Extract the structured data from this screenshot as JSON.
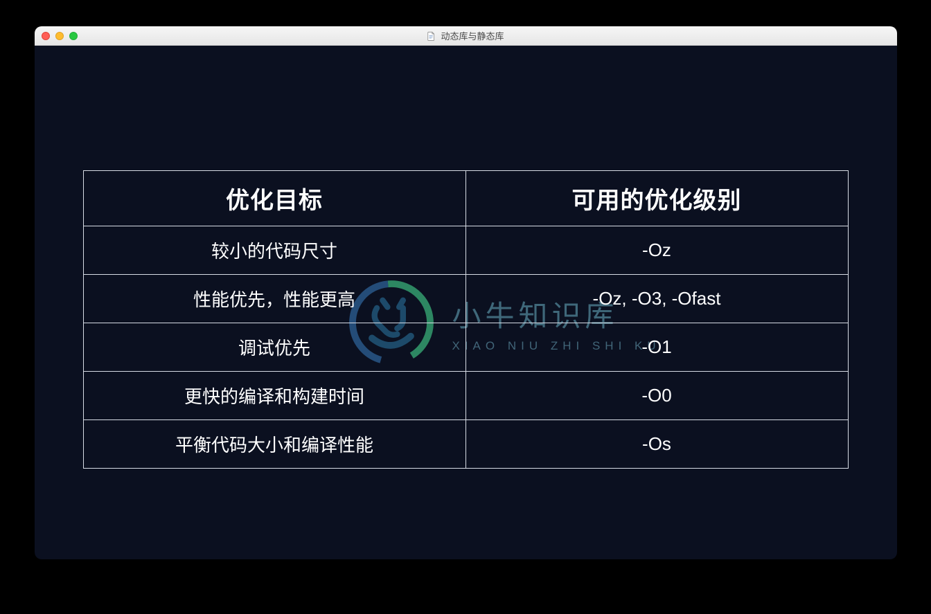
{
  "window": {
    "title": "动态库与静态库"
  },
  "table": {
    "header": {
      "goal": "优化目标",
      "levels": "可用的优化级别"
    },
    "rows": [
      {
        "goal": "较小的代码尺寸",
        "levels": "-Oz"
      },
      {
        "goal": "性能优先，性能更高",
        "levels": "-Oz, -O3, -Ofast"
      },
      {
        "goal": "调试优先",
        "levels": "-O1"
      },
      {
        "goal": "更快的编译和构建时间",
        "levels": "-O0"
      },
      {
        "goal": "平衡代码大小和编译性能",
        "levels": "-Os"
      }
    ]
  },
  "watermark": {
    "zh": "小牛知识库",
    "pinyin": "XIAO NIU ZHI SHI KU"
  }
}
